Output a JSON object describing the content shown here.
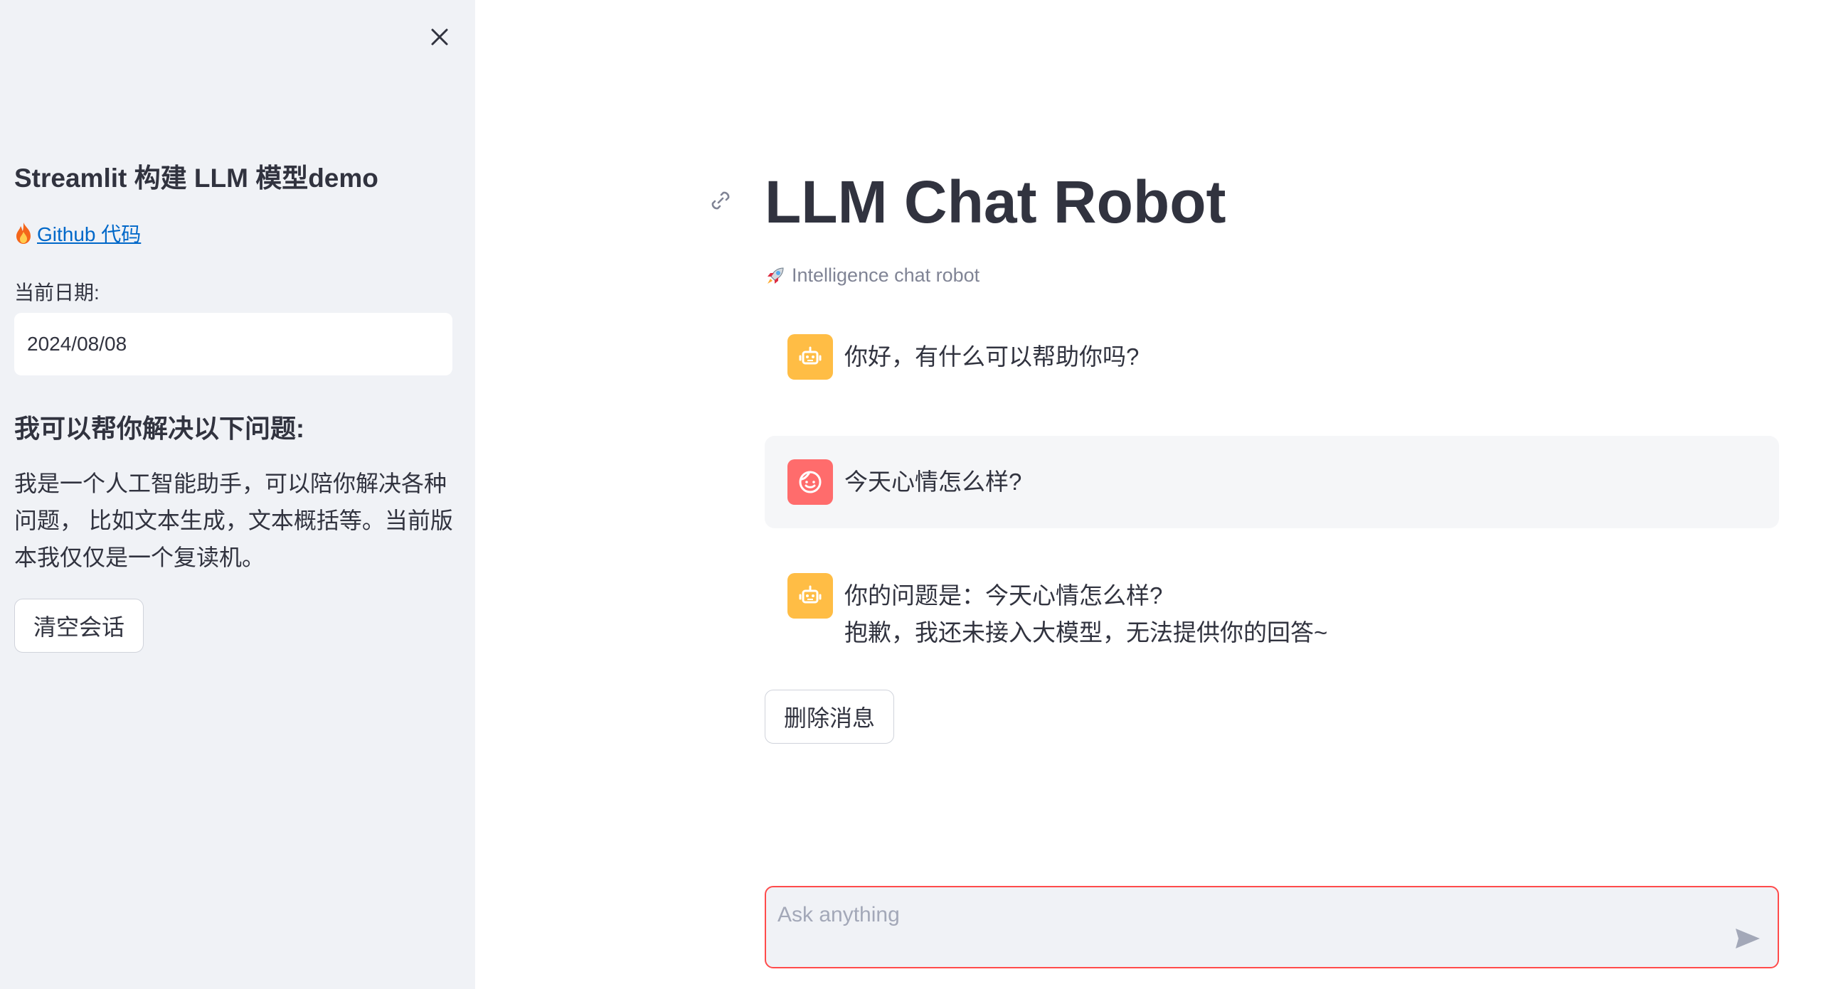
{
  "sidebar": {
    "title": "Streamlit 构建 LLM 模型demo",
    "link_text": "Github 代码",
    "date_label": "当前日期:",
    "date_value": "2024/08/08",
    "subheading": "我可以帮你解决以下问题:",
    "description": "我是一个人工智能助手，可以陪你解决各种问题， 比如文本生成，文本概括等。当前版本我仅仅是一个复读机。",
    "clear_button": "清空会话"
  },
  "main": {
    "title": "LLM Chat Robot",
    "caption": "Intelligence chat robot",
    "messages": [
      {
        "role": "assistant",
        "line1": "你好，有什么可以帮助你吗?"
      },
      {
        "role": "user",
        "line1": "今天心情怎么样?"
      },
      {
        "role": "assistant",
        "line1": "你的问题是：今天心情怎么样?",
        "line2": "抱歉，我还未接入大模型，无法提供你的回答~"
      }
    ],
    "delete_button": "删除消息",
    "chat_input": {
      "placeholder": "Ask anything",
      "value": ""
    }
  },
  "colors": {
    "accent": "#ff4b4b",
    "bot_avatar": "#ffbd45",
    "user_avatar": "#ff6c6c",
    "link": "#0068c9",
    "sidebar_bg": "#f0f2f6"
  },
  "icons": [
    "close-icon",
    "fire-icon",
    "link-icon",
    "rocket-icon",
    "bot-icon",
    "user-face-icon",
    "send-icon"
  ]
}
